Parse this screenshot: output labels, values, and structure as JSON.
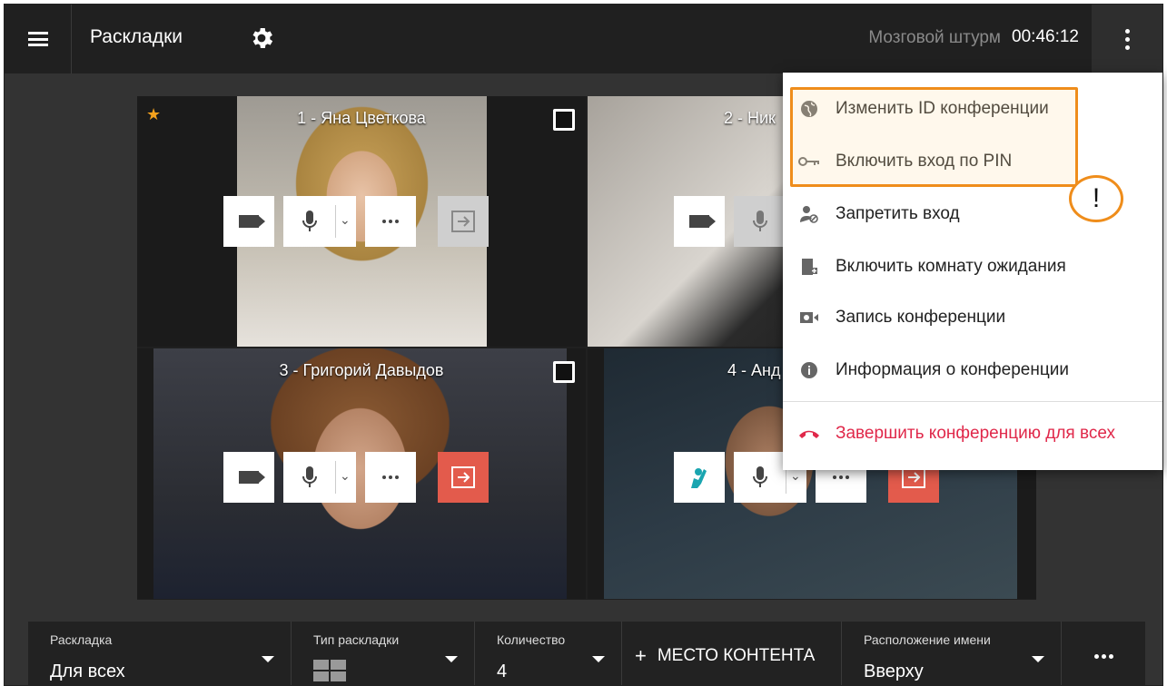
{
  "topbar": {
    "title": "Раскладки",
    "conference_name": "Мозговой штурм",
    "timer": "00:46:12"
  },
  "tiles": [
    {
      "name": "1 - Яна Цветкова",
      "star": true
    },
    {
      "name": "2 - Ник"
    },
    {
      "name": "3 - Григорий Давыдов"
    },
    {
      "name": "4 - Анд"
    }
  ],
  "menu": {
    "items": [
      {
        "label": "Изменить ID конференции",
        "icon": "globe-icon"
      },
      {
        "label": "Включить вход по PIN",
        "icon": "key-icon"
      },
      {
        "label": "Запретить вход",
        "icon": "user-block-icon"
      },
      {
        "label": "Включить комнату ожидания",
        "icon": "waiting-room-icon"
      },
      {
        "label": "Запись конференции",
        "icon": "record-icon"
      },
      {
        "label": "Информация о конференции",
        "icon": "info-icon"
      },
      {
        "label": "Завершить конференцию для всех",
        "icon": "hangup-icon",
        "color": "#e0284a"
      }
    ],
    "highlight_color": "#ef8d1b",
    "warning_mark": "!"
  },
  "bottombar": {
    "layout": {
      "label": "Раскладка",
      "value": "Для всех"
    },
    "layout_type": {
      "label": "Тип раскладки"
    },
    "count": {
      "label": "Количество",
      "value": "4"
    },
    "content_place": {
      "plus": "+",
      "label": "МЕСТО КОНТЕНТА"
    },
    "name_position": {
      "label": "Расположение имени",
      "value": "Вверху"
    }
  },
  "colors": {
    "accent_orange": "#ef8d1b",
    "danger_red": "#e35b4c",
    "raise_hand_teal": "#1aa5b0"
  }
}
